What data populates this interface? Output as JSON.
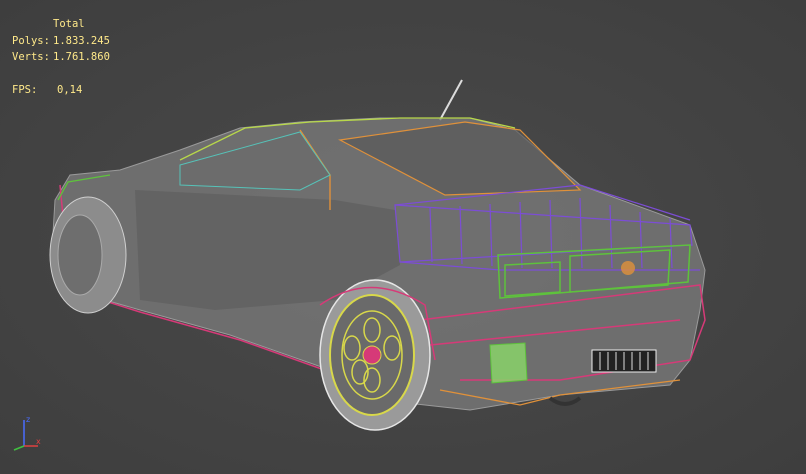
{
  "stats": {
    "header": "Total",
    "polys_label": "Polys:",
    "polys_value": "1.833.245",
    "verts_label": "Verts:",
    "verts_value": "1.761.860",
    "fps_label": "FPS:",
    "fps_value": "0,14"
  },
  "colors": {
    "background": "#444444",
    "stats_text": "#ffe98a",
    "body_shell": "#8a8a8a",
    "wire_purple": "#7c4dd6",
    "wire_green": "#5ec23c",
    "wire_orange": "#e0913a",
    "wire_magenta": "#d63a78",
    "wire_yellow": "#d8d84a",
    "wire_white": "#d8d8d8"
  },
  "gizmo": {
    "x_axis": "x",
    "y_axis": "z"
  }
}
